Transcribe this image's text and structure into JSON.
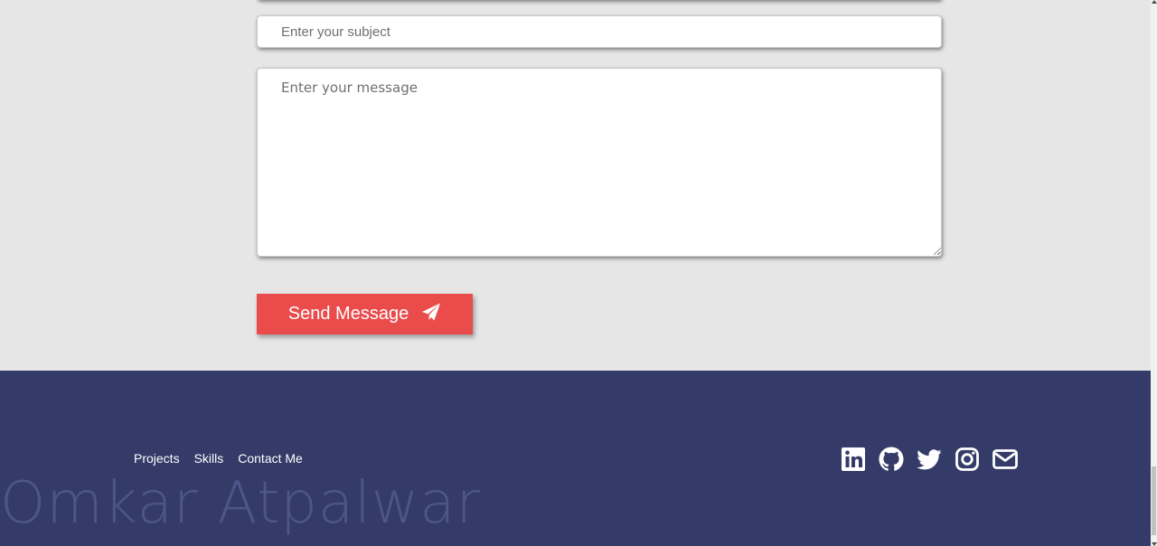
{
  "contact_form": {
    "subject_placeholder": "Enter your subject",
    "message_placeholder": "Enter your message",
    "send_button_label": "Send Message",
    "send_icon": "paper-plane-icon",
    "button_color": "#ea4b4b"
  },
  "footer": {
    "background_color": "#343b68",
    "nav_links": [
      "Projects",
      "Skills",
      "Contact Me"
    ],
    "brand_name": "Omkar Atpalwar",
    "social_icons": [
      "linkedin-icon",
      "github-icon",
      "twitter-icon",
      "instagram-icon",
      "envelope-icon"
    ]
  },
  "page": {
    "background_color": "#e6e6e6"
  }
}
